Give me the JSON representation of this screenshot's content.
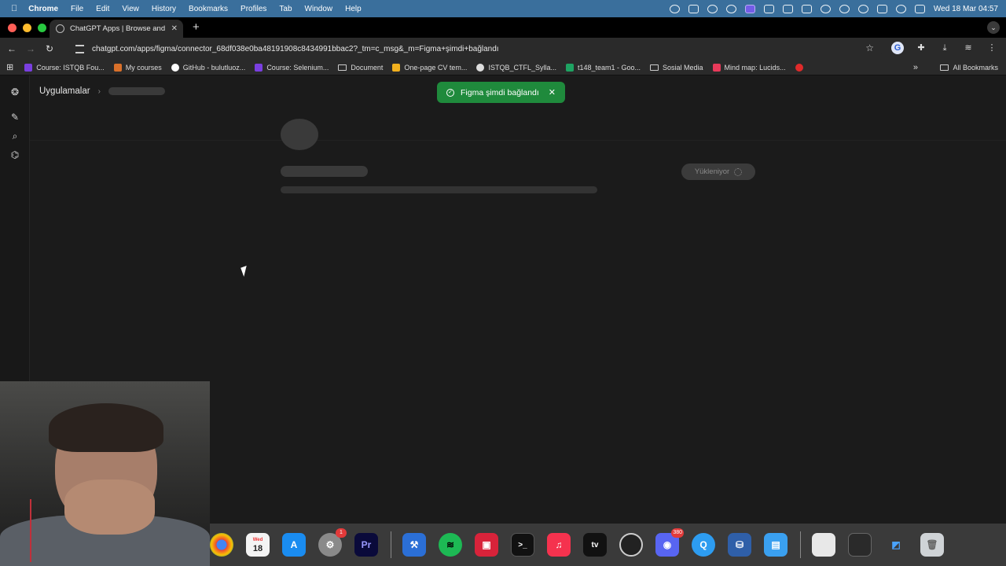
{
  "menubar": {
    "app": "Chrome",
    "menus": [
      "File",
      "Edit",
      "View",
      "History",
      "Bookmarks",
      "Profiles",
      "Tab",
      "Window",
      "Help"
    ],
    "clock": "Wed 18 Mar  04:57"
  },
  "browser": {
    "tab_title": "ChatGPT Apps | Browse and",
    "url": "chatgpt.com/apps/figma/connector_68df038e0ba48191908c8434991bbac2?_tm=c_msg&_m=Figma+şimdi+bağlandı",
    "bookmarks": [
      {
        "label": "Course: ISTQB Fou...",
        "color": "#7a3fe0"
      },
      {
        "label": "My courses",
        "color": "#d9702a"
      },
      {
        "label": "GitHub - bulutluoz...",
        "color": "#ffffff"
      },
      {
        "label": "Course: Selenium...",
        "color": "#7a3fe0"
      },
      {
        "label": "Document",
        "color": "folder"
      },
      {
        "label": "One-page CV tem...",
        "color": "#f2b01e"
      },
      {
        "label": "ISTQB_CTFL_Sylla...",
        "color": "#dddddd"
      },
      {
        "label": "t148_team1 - Goo...",
        "color": "#1ea362"
      },
      {
        "label": "Sosial Media",
        "color": "folder"
      },
      {
        "label": "Mind map: Lucids...",
        "color": "#e83a5a"
      }
    ],
    "all_bookmarks": "All Bookmarks"
  },
  "page": {
    "breadcrumb_root": "Uygulamalar",
    "toast_text": "Figma şimdi bağlandı",
    "loading_button": "Yükleniyor"
  },
  "dock": {
    "calendar_month": "Wed",
    "calendar_day": "18",
    "settings_badge": "1",
    "discord_badge": "380",
    "premiere_label": "Pr",
    "tv_label": "tv"
  },
  "colors": {
    "toast": "#1f8a3c",
    "menubar": "#3a6f9c",
    "background": "#1b1b1b"
  }
}
